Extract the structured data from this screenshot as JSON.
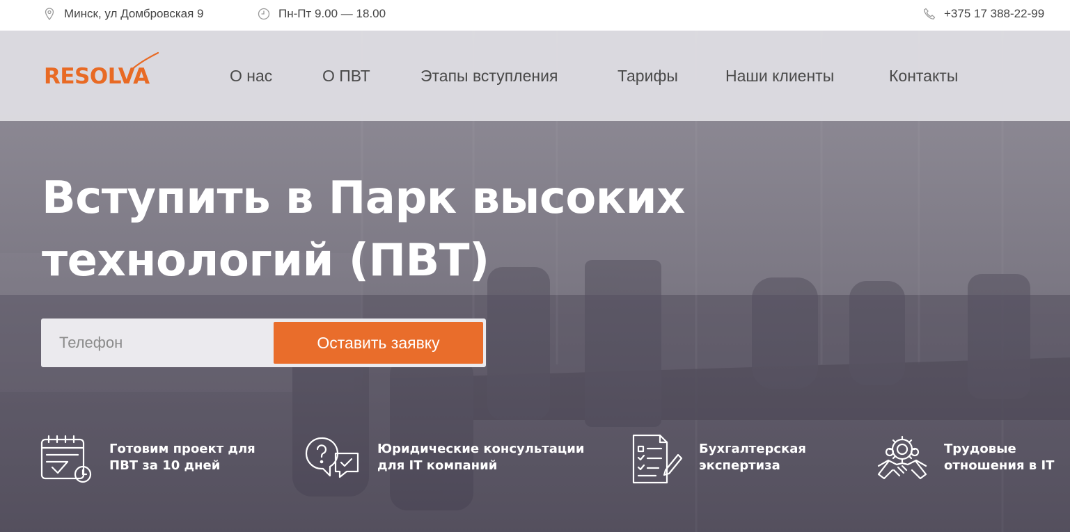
{
  "topbar": {
    "address": "Минск, ул Домбровская 9",
    "hours": "Пн-Пт 9.00 — 18.00",
    "phone": "+375 17 388-22-99"
  },
  "brand": {
    "logo_text": "RESOLVA",
    "accent": "#e86a24"
  },
  "nav": {
    "items": [
      {
        "label": "О нас"
      },
      {
        "label": "О ПВТ"
      },
      {
        "label": "Этапы вступления"
      },
      {
        "label": "Тарифы"
      },
      {
        "label": "Наши клиенты"
      },
      {
        "label": "Контакты"
      }
    ]
  },
  "hero": {
    "title_line1": "Вступить в Парк высоких",
    "title_line2": "технологий (ПВТ)",
    "phone_placeholder": "Телефон",
    "submit_label": "Оставить заявку"
  },
  "features": [
    {
      "icon": "calendar-check-icon",
      "line1": "Готовим проект для",
      "line2": "ПВТ за 10 дней"
    },
    {
      "icon": "chat-question-icon",
      "line1": "Юридические консультации",
      "line2": "для IT компаний"
    },
    {
      "icon": "checklist-pen-icon",
      "line1": "Бухгалтерская",
      "line2": "экспертиза"
    },
    {
      "icon": "handshake-gear-icon",
      "line1": "Трудовые",
      "line2": "отношения в IT"
    }
  ],
  "colors": {
    "button": "#e96d2b",
    "nav_text": "#4a4a4a",
    "hero_overlay": "#6f6b77"
  }
}
